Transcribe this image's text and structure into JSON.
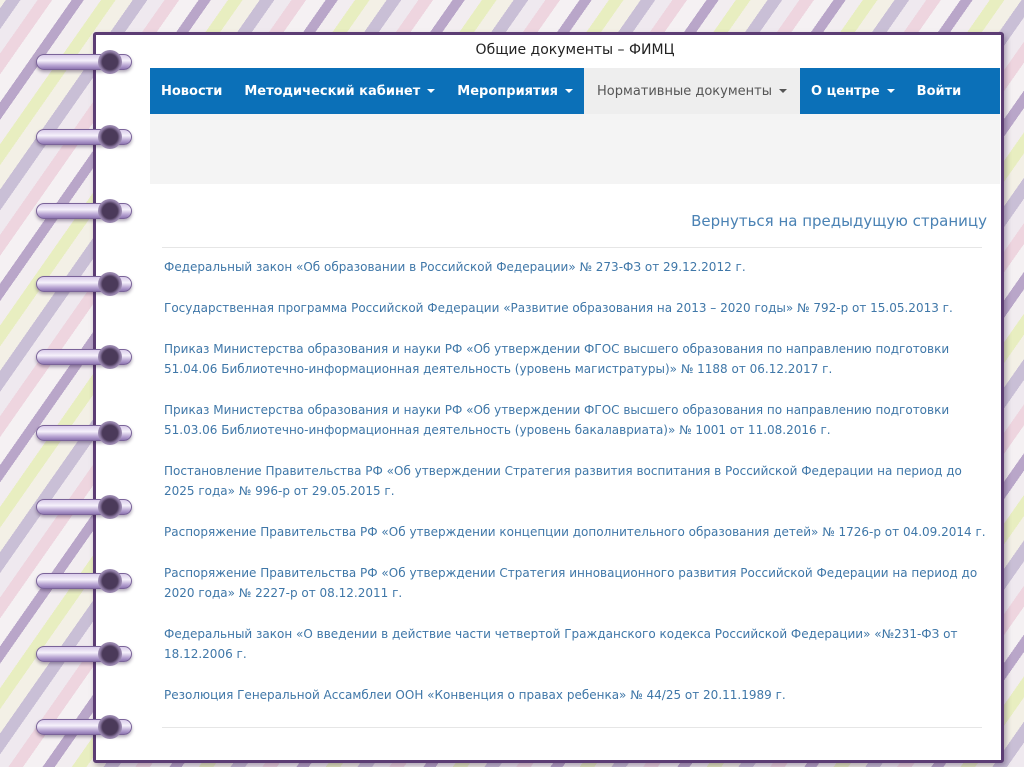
{
  "window": {
    "title": "Общие документы – ФИМЦ"
  },
  "nav": {
    "items": [
      {
        "label": "Новости",
        "dropdown": false,
        "active": false
      },
      {
        "label": "Методический кабинет",
        "dropdown": true,
        "active": false
      },
      {
        "label": "Мероприятия",
        "dropdown": true,
        "active": false
      },
      {
        "label": "Нормативные документы",
        "dropdown": true,
        "active": true
      },
      {
        "label": "О центре",
        "dropdown": true,
        "active": false
      },
      {
        "label": "Войти",
        "dropdown": false,
        "active": false
      }
    ]
  },
  "content": {
    "back_link": "Вернуться на предыдущую страницу",
    "documents": [
      "Федеральный закон «Об образовании в Российской Федерации» № 273-ФЗ от 29.12.2012 г.",
      "Государственная программа Российской Федерации «Развитие образования на 2013 – 2020 годы» № 792-р от 15.05.2013 г.",
      "Приказ Министерства образования и науки РФ «Об утверждении ФГОС высшего образования по направлению подготовки 51.04.06 Библиотечно-информационная деятельность (уровень магистратуры)» № 1188 от 06.12.2017 г.",
      "Приказ Министерства образования и науки РФ «Об утверждении ФГОС высшего образования по направлению подготовки 51.03.06 Библиотечно-информационная деятельность (уровень бакалавриата)» № 1001 от 11.08.2016 г.",
      "Постановление Правительства РФ «Об утверждении Стратегия развития воспитания в Российской Федерации на период до 2025 года» № 996-р от 29.05.2015 г.",
      "Распоряжение Правительства РФ «Об утверждении концепции дополнительного образования детей» № 1726-р от 04.09.2014 г.",
      "Распоряжение Правительства РФ «Об утверждении Стратегия инновационного развития Российской Федерации на период до 2020 года» № 2227-р от 08.12.2011 г.",
      "Федеральный закон «О введении в действие части четвертой Гражданского кодекса Российской Федерации» «№231-ФЗ от 18.12.2006 г.",
      "Резолюция Генеральной Ассамблеи ООН «Конвенция о правах ребенка» № 44/25 от 20.11.1989 г."
    ]
  },
  "colors": {
    "nav_bg": "#0b70b8",
    "link": "#3f77a8",
    "frame": "#5c3d74"
  }
}
